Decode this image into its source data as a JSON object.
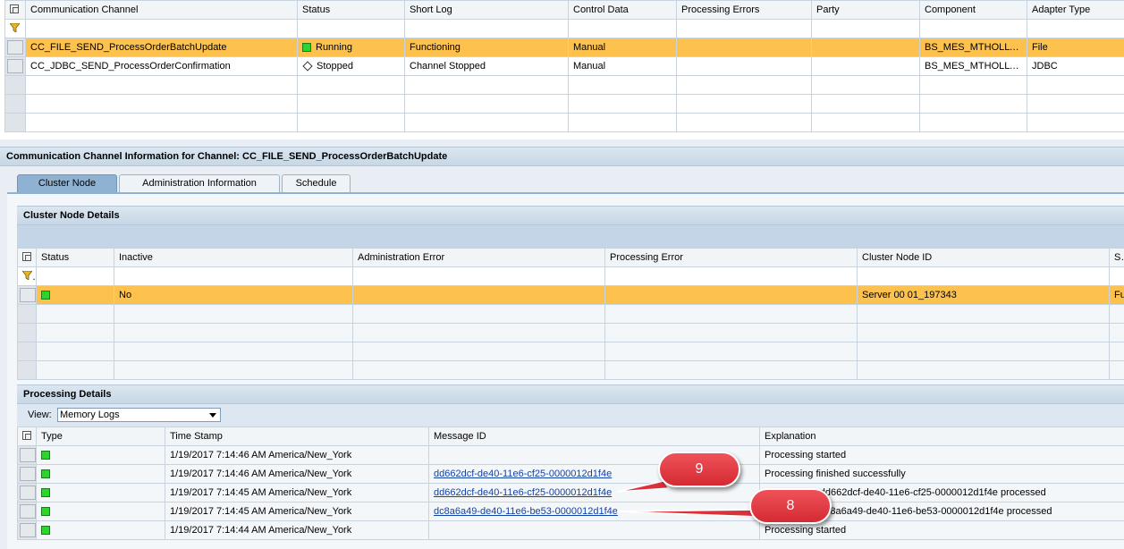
{
  "channels": {
    "headers": [
      "Communication Channel",
      "Status",
      "Short Log",
      "Control Data",
      "Processing Errors",
      "Party",
      "Component",
      "Adapter Type"
    ],
    "rows": [
      {
        "channel": "CC_FILE_SEND_ProcessOrderBatchUpdate",
        "status": "Running",
        "status_icon": "green-square-icon",
        "short_log": "Functioning",
        "control": "Manual",
        "errors": "",
        "party": "",
        "component": "BS_MES_MTHOLLY…",
        "adapter": "File"
      },
      {
        "channel": "CC_JDBC_SEND_ProcessOrderConfirmation",
        "status": "Stopped",
        "status_icon": "diamond-icon",
        "short_log": "Channel Stopped",
        "control": "Manual",
        "errors": "",
        "party": "",
        "component": "BS_MES_MTHOLLY…",
        "adapter": "JDBC"
      }
    ]
  },
  "info_title": "Communication Channel Information for Channel: CC_FILE_SEND_ProcessOrderBatchUpdate",
  "tabs": [
    {
      "label": "Cluster Node",
      "active": true
    },
    {
      "label": "Administration Information",
      "active": false
    },
    {
      "label": "Schedule",
      "active": false
    }
  ],
  "cluster": {
    "title": "Cluster Node Details",
    "headers": [
      "Status",
      "Inactive",
      "Administration Error",
      "Processing Error",
      "Cluster Node ID",
      "Sh"
    ],
    "row": {
      "inactive": "No",
      "admin_error": "",
      "proc_error": "",
      "node_id": "Server 00 01_197343",
      "short": "Fu"
    }
  },
  "processing": {
    "title": "Processing Details",
    "view_label": "View:",
    "view_value": "Memory Logs",
    "headers": [
      "Type",
      "Time Stamp",
      "Message ID",
      "Explanation"
    ],
    "rows": [
      {
        "time": "1/19/2017 7:14:46 AM America/New_York",
        "msg": "",
        "expl": "Processing started"
      },
      {
        "time": "1/19/2017 7:14:46 AM America/New_York",
        "msg": "dd662dcf-de40-11e6-cf25-0000012d1f4e",
        "expl": "Processing finished successfully"
      },
      {
        "time": "1/19/2017 7:14:45 AM America/New_York",
        "msg": "dd662dcf-de40-11e6-cf25-0000012d1f4e",
        "expl": "Message ID dd662dcf-de40-11e6-cf25-0000012d1f4e processed"
      },
      {
        "time": "1/19/2017 7:14:45 AM America/New_York",
        "msg": "dc8a6a49-de40-11e6-be53-0000012d1f4e",
        "expl": "Message ID dc8a6a49-de40-11e6-be53-0000012d1f4e processed"
      },
      {
        "time": "1/19/2017 7:14:44 AM America/New_York",
        "msg": "",
        "expl": "Processing started"
      }
    ]
  },
  "callouts": [
    {
      "label": "9"
    },
    {
      "label": "8"
    }
  ],
  "colors": {
    "selected_row": "#fdc14d",
    "status_green": "#2bd52b",
    "callout_red": "#e03a42",
    "link": "#1542a5"
  }
}
